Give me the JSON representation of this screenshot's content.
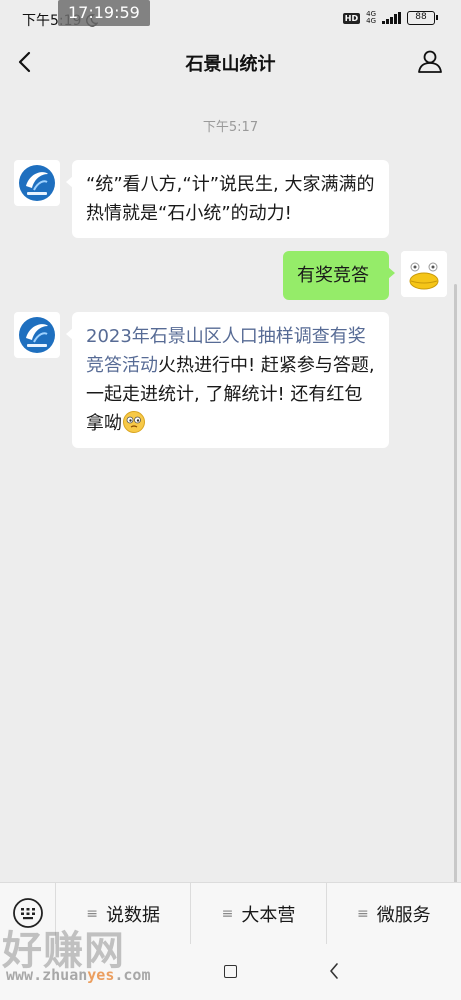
{
  "status_bar": {
    "left_time": "下午5:19",
    "overlay_time": "17:19:59",
    "hd": "HD",
    "net_top": "4G",
    "net_bottom": "4G",
    "battery": "88"
  },
  "header": {
    "title": "石景山统计"
  },
  "chat": {
    "timestamp": "下午5:17",
    "messages": [
      {
        "side": "left",
        "text": "“统”看八方,“计”说民生, 大家满满的热情就是“石小统”的动力!"
      },
      {
        "side": "right",
        "text": "有奖竞答"
      },
      {
        "side": "left",
        "link_text": "2023年石景山区人口抽样调查有奖竞答活动",
        "text": "火热进行中! 赶紧参与答题, 一起走进统计, 了解统计! 还有红包拿呦"
      }
    ]
  },
  "menu": {
    "items": [
      "说数据",
      "大本营",
      "微服务"
    ]
  },
  "watermark": {
    "text": "好赚网",
    "url_prefix": "www.zhuan",
    "url_highlight": "yes",
    "url_suffix": ".com"
  },
  "colors": {
    "background": "#ededed",
    "bubble_right": "#95ec69",
    "link": "#576b95"
  },
  "icons": [
    "back-arrow-icon",
    "profile-icon",
    "keyboard-icon",
    "menu-lines-icon",
    "emoji-icon",
    "nav-home-icon",
    "nav-back-icon"
  ]
}
